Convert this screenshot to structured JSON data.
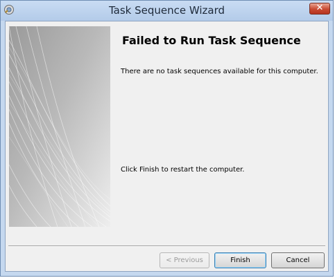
{
  "window": {
    "title": "Task Sequence Wizard"
  },
  "content": {
    "heading": "Failed to Run Task Sequence",
    "message": "There are no task sequences available for this computer.",
    "instruction": "Click Finish to restart the computer."
  },
  "buttons": {
    "previous": "< Previous",
    "finish": "Finish",
    "cancel": "Cancel"
  },
  "icons": {
    "app": "task-sequence-app-icon",
    "close": "close-icon"
  },
  "colors": {
    "titlebar": "#c9dcf3",
    "close_button": "#c84a32",
    "client_background": "#f0f0f0"
  }
}
